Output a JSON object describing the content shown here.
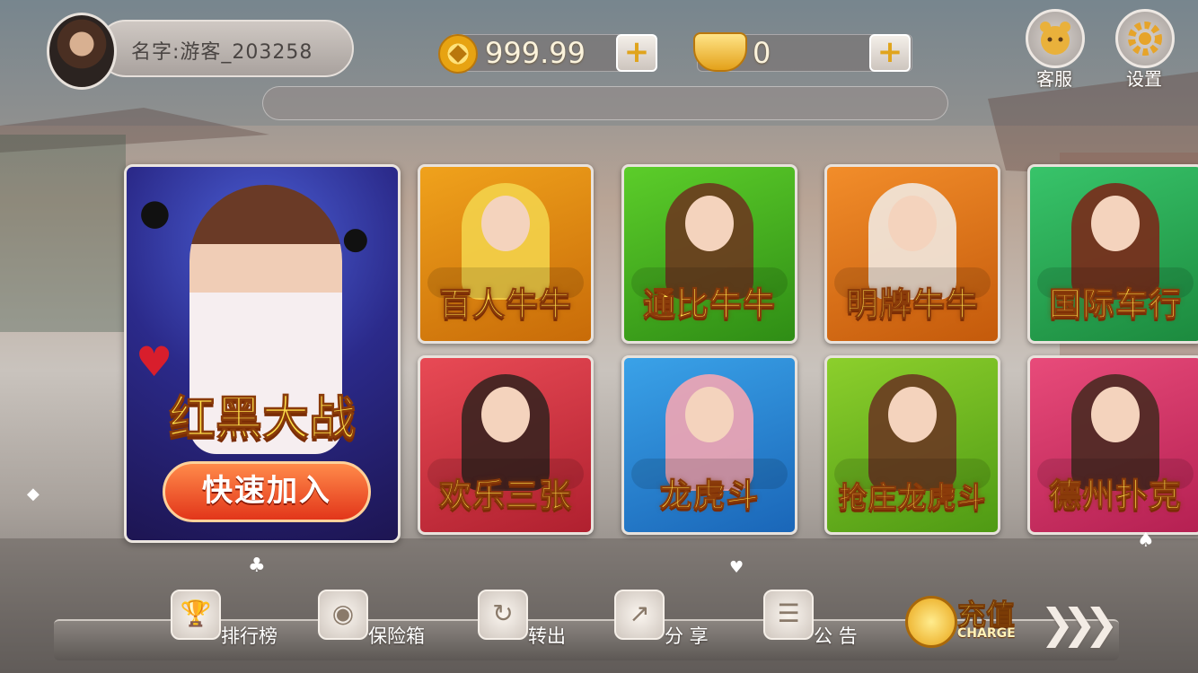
{
  "player": {
    "name_label": "名字:游客_203258"
  },
  "currency": {
    "coins": "999.99",
    "gold": "0",
    "plus_symbol": "+"
  },
  "top_buttons": {
    "service_label": "客服",
    "settings_label": "设置"
  },
  "featured": {
    "title": "红黑大战",
    "join_label": "快速加入"
  },
  "games": [
    {
      "label": "百人牛牛",
      "bg": "#f0a21c",
      "bg2": "#c86b08",
      "figure": "#f3d24a"
    },
    {
      "label": "通比牛牛",
      "bg": "#5ccd2a",
      "bg2": "#2f8d15",
      "figure": "#6b3a1f"
    },
    {
      "label": "明牌牛牛",
      "bg": "#f28d2a",
      "bg2": "#c45a0b",
      "figure": "#f1e8df"
    },
    {
      "label": "国际车行",
      "bg": "#38c46a",
      "bg2": "#1c8a3e",
      "figure": "#7a2a1b"
    },
    {
      "label": "欢乐三张",
      "bg": "#e84a55",
      "bg2": "#b0202f",
      "figure": "#3a2420"
    },
    {
      "label": "龙虎斗",
      "bg": "#3aa2e8",
      "bg2": "#1a66b8",
      "figure": "#f3a5b3"
    },
    {
      "label": "抢庄龙虎斗",
      "bg": "#8ccf2c",
      "bg2": "#4f9a14",
      "figure": "#6a3a22"
    },
    {
      "label": "德州扑克",
      "bg": "#e84b7a",
      "bg2": "#b52052",
      "figure": "#4a2a22"
    }
  ],
  "bottom_menu": [
    {
      "label": "排行榜",
      "icon": "trophy-icon",
      "glyph": "🏆"
    },
    {
      "label": "保险箱",
      "icon": "safe-icon",
      "glyph": "◉"
    },
    {
      "label": "转出",
      "icon": "transfer-icon",
      "glyph": "↻"
    },
    {
      "label": "分 享",
      "icon": "share-icon",
      "glyph": "↗"
    },
    {
      "label": "公 告",
      "icon": "notice-icon",
      "glyph": "☰"
    }
  ],
  "charge": {
    "main_label": "充值",
    "sub_label": "CHARGE"
  },
  "colors": {
    "title_yellow": "#ffe14a",
    "title_outline": "#8a3b0a"
  }
}
